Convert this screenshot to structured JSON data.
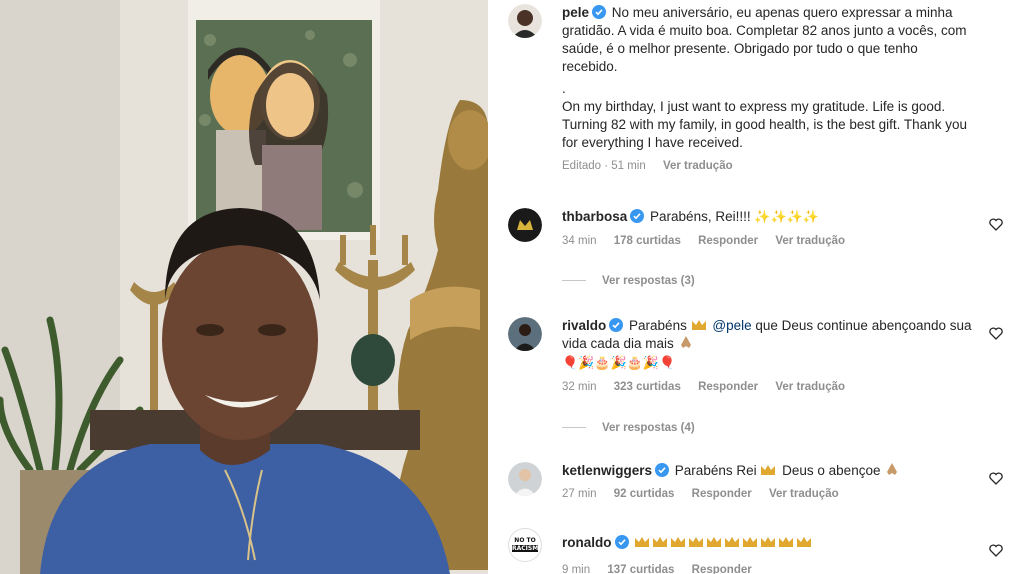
{
  "post": {
    "author": "pele",
    "caption_pt": "No meu aniversário, eu apenas quero expressar a minha gratidão. A vida é muito boa. Completar 82 anos junto a vocês, com saúde, é o melhor presente. Obrigado por tudo o que tenho recebido.",
    "separator": ".",
    "caption_en": "On my birthday, I just want to express my gratitude. Life is good. Turning 82 with my family, in good health, is the best gift. Thank you for everything I have received.",
    "edited_label": "Editado · 51 min",
    "translate_label": "Ver tradução"
  },
  "comments": [
    {
      "user": "thbarbosa",
      "text": "Parabéns, Rei!!!!",
      "emoji_suffix": "✨✨✨✨",
      "time": "34 min",
      "likes": "178 curtidas",
      "reply": "Responder",
      "translate": "Ver tradução",
      "view_replies": "Ver respostas (3)"
    },
    {
      "user": "rivaldo",
      "text_before": "Parabéns",
      "mention": "@pele",
      "text_after": "que Deus continue abençoando sua vida cada dia mais",
      "emoji_line": "🎈🎉🎂🎉🎂🎉🎈",
      "time": "32 min",
      "likes": "323 curtidas",
      "reply": "Responder",
      "translate": "Ver tradução",
      "view_replies": "Ver respostas (4)"
    },
    {
      "user": "ketlenwiggers",
      "text_before": "Parabéns Rei",
      "text_after": "Deus o abençoe",
      "time": "27 min",
      "likes": "92 curtidas",
      "reply": "Responder",
      "translate": "Ver tradução"
    },
    {
      "user": "ronaldo",
      "avatar_text_top": "NO TO",
      "avatar_text_bottom": "RACISM",
      "time": "9 min",
      "likes": "137 curtidas",
      "reply": "Responder"
    }
  ],
  "colors": {
    "verified": "#3897f0",
    "text": "#262626",
    "secondary": "#8e8e8e",
    "link": "#00376b"
  }
}
